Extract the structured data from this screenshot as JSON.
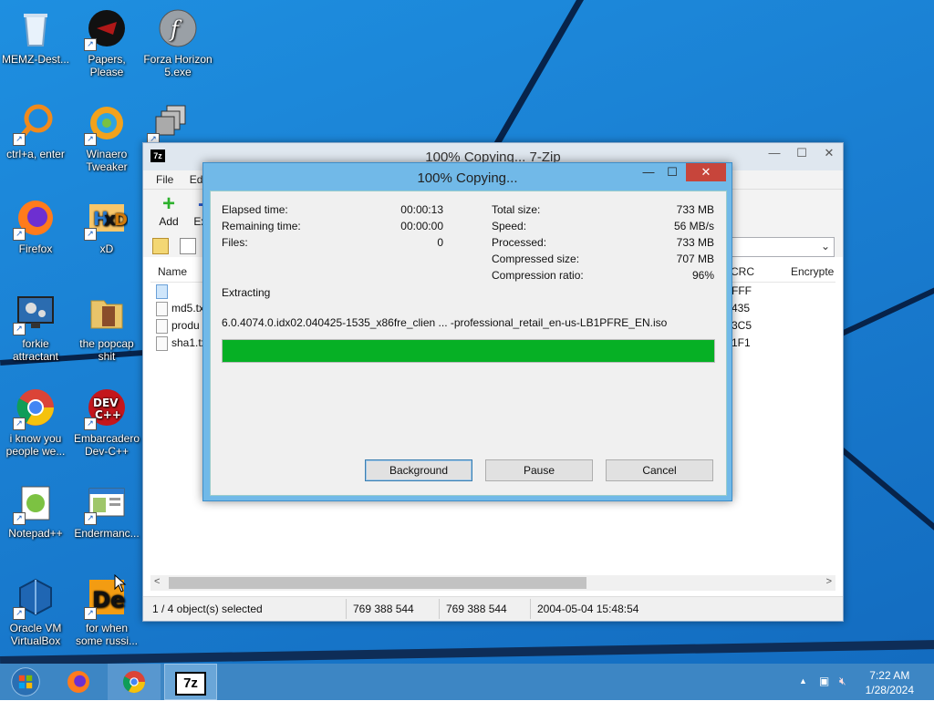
{
  "desktop": {
    "icons": [
      {
        "label": "MEMZ-Dest..."
      },
      {
        "label": "Papers, Please"
      },
      {
        "label": "Forza Horizon 5.exe"
      },
      {
        "label": "ctrl+a, enter"
      },
      {
        "label": "Winaero Tweaker"
      },
      {
        "label": "Firefox"
      },
      {
        "label": "xD"
      },
      {
        "label": "forkie attractant"
      },
      {
        "label": "the popcap shit"
      },
      {
        "label": "i know you people we..."
      },
      {
        "label": "Embarcadero Dev-C++"
      },
      {
        "label": "Notepad++"
      },
      {
        "label": "Endermanc..."
      },
      {
        "label": "Oracle VM VirtualBox"
      },
      {
        "label": "for when some russi..."
      }
    ]
  },
  "zipwindow": {
    "title": "100% Copying... 7-Zip",
    "app_icon": "7z",
    "menu": [
      "File",
      "Edit"
    ],
    "toolbar": {
      "add": "Add",
      "extract": "Ext"
    },
    "columns": {
      "name": "Name",
      "crc": "CRC",
      "encrypted": "Encrypte"
    },
    "files": [
      {
        "name": "",
        "crc": "FFF"
      },
      {
        "name": "md5.tx",
        "crc": "435"
      },
      {
        "name": "produ",
        "crc": "3C5"
      },
      {
        "name": "sha1.tx",
        "crc": "1F1"
      }
    ],
    "status": {
      "selected": "1 / 4 object(s) selected",
      "size1": "769 388 544",
      "size2": "769 388 544",
      "modified": "2004-05-04 15:48:54"
    }
  },
  "dialog": {
    "title": "100% Copying...",
    "left_stats": [
      {
        "label": "Elapsed time:",
        "value": "00:00:13"
      },
      {
        "label": "Remaining time:",
        "value": "00:00:00"
      },
      {
        "label": "Files:",
        "value": "0"
      }
    ],
    "right_stats": [
      {
        "label": "Total size:",
        "value": "733 MB"
      },
      {
        "label": "Speed:",
        "value": "56 MB/s"
      },
      {
        "label": "Processed:",
        "value": "733 MB"
      },
      {
        "label": "Compressed size:",
        "value": "707 MB"
      },
      {
        "label": "Compression ratio:",
        "value": "96%"
      }
    ],
    "operation": "Extracting",
    "current_file": "6.0.4074.0.idx02.040425-1535_x86fre_clien ... -professional_retail_en-us-LB1PFRE_EN.iso",
    "progress_fraction": 1.0,
    "buttons": {
      "background": "Background",
      "pause": "Pause",
      "cancel": "Cancel"
    }
  },
  "taskbar": {
    "clock_time": "7:22 AM",
    "clock_date": "1/28/2024",
    "active_app": "7z"
  },
  "colors": {
    "desktop_blue": "#1a7fd2",
    "progress_green": "#06b025",
    "dialog_frame": "#71b9e8",
    "close_red": "#c7453b"
  }
}
